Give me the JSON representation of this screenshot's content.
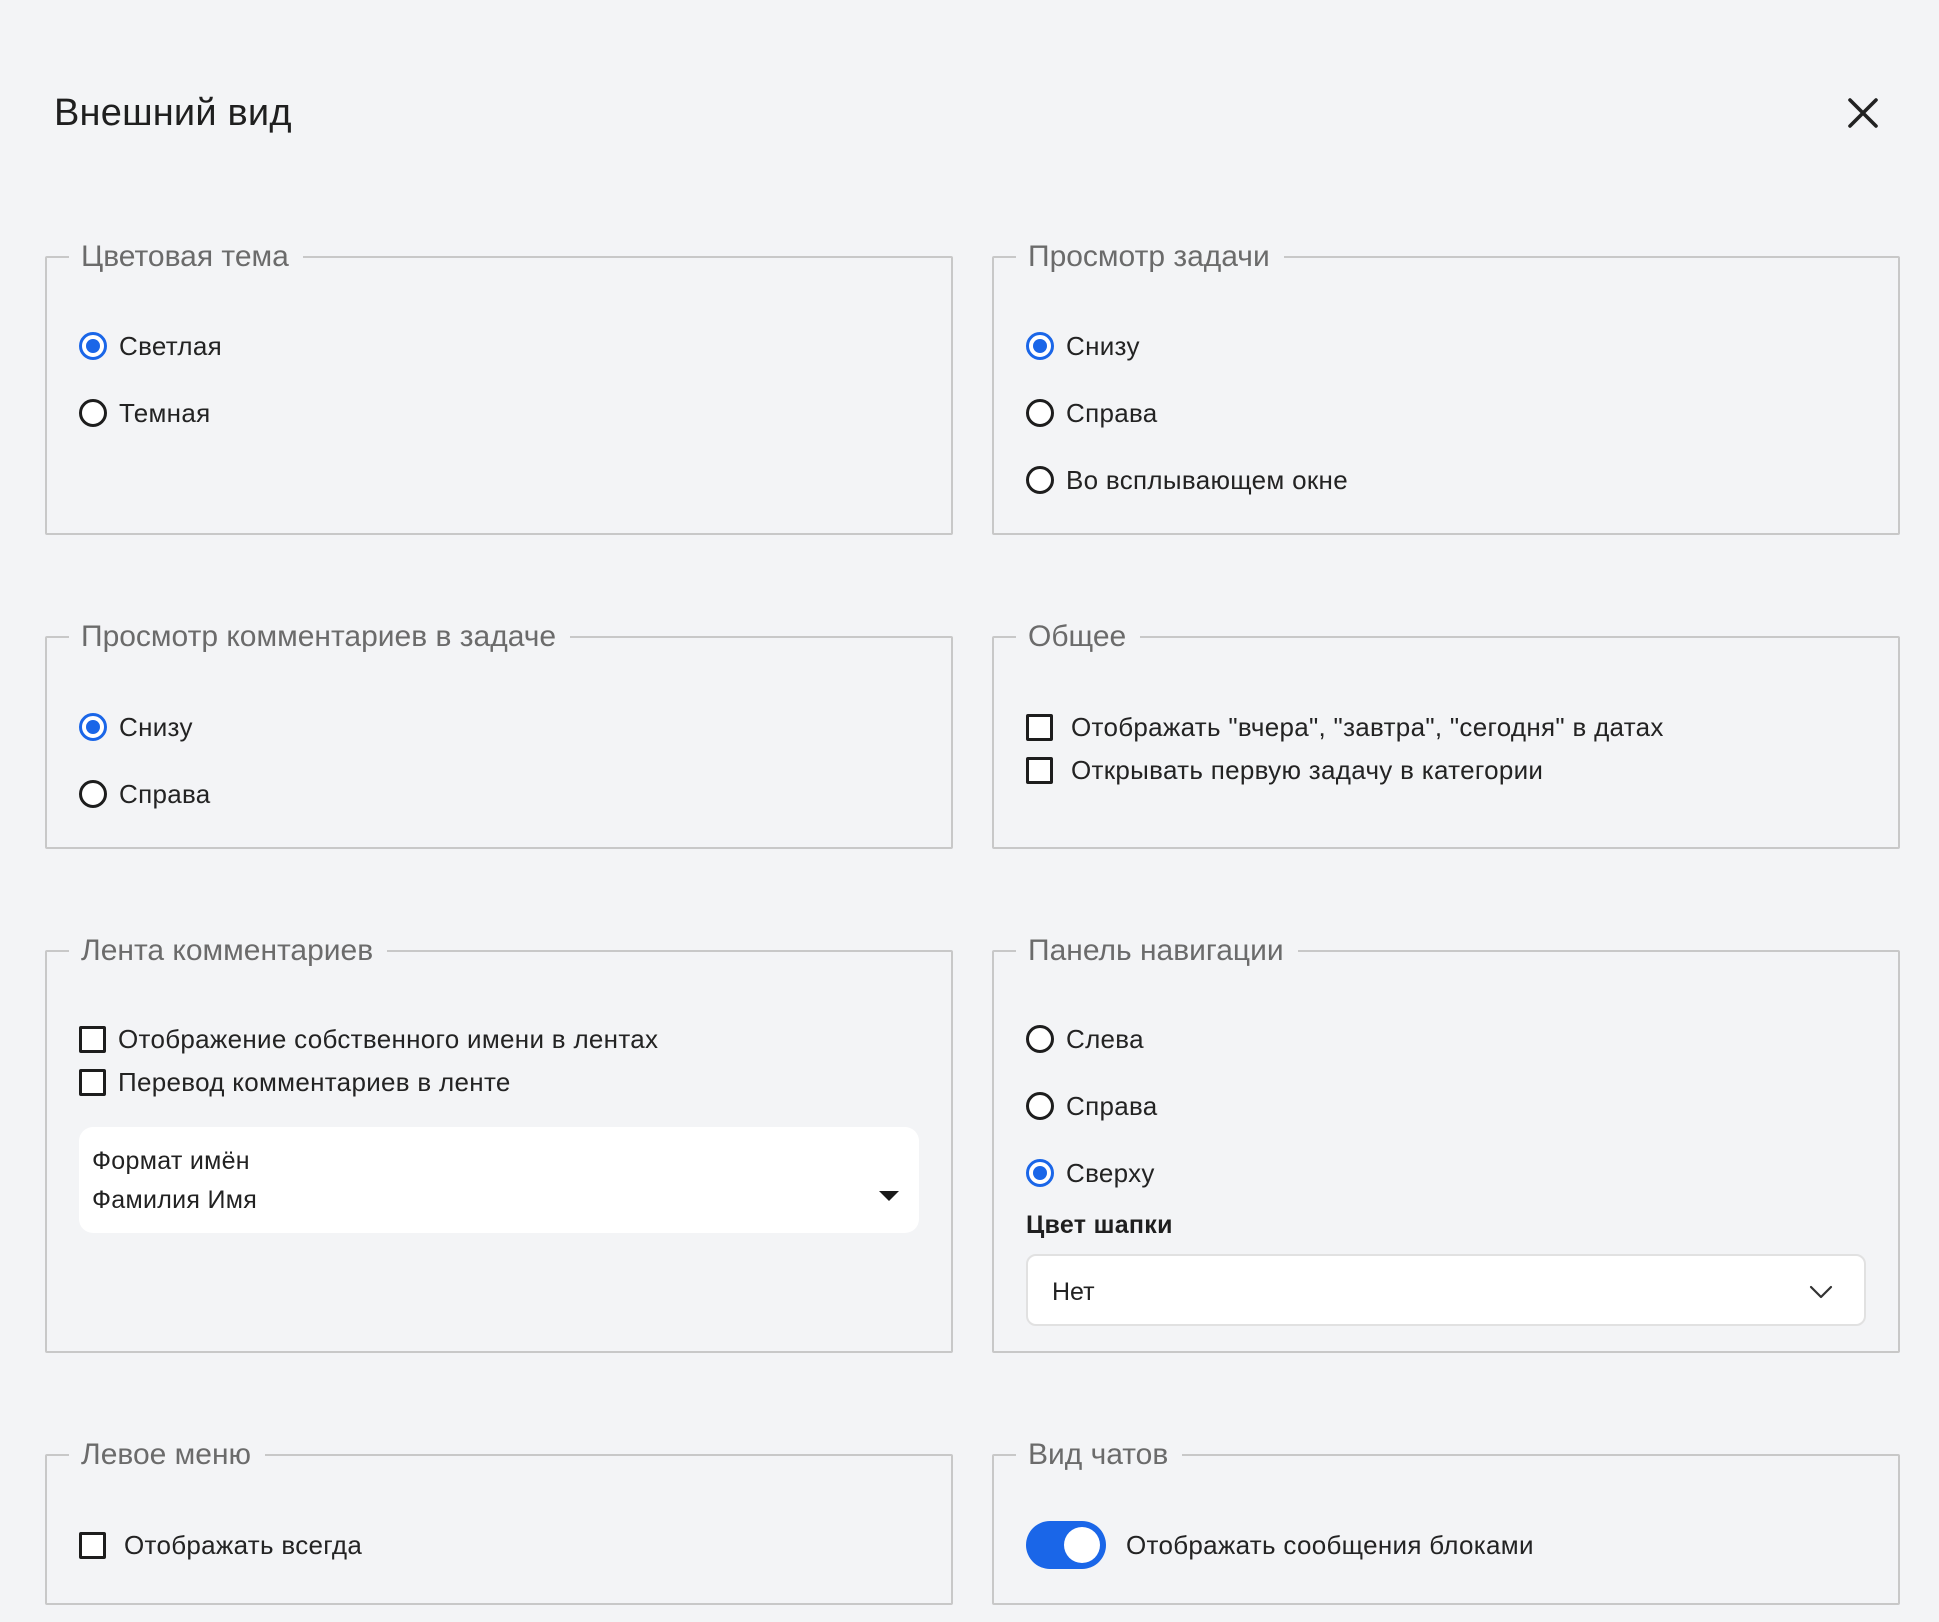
{
  "header": {
    "title": "Внешний вид"
  },
  "color_theme": {
    "title": "Цветовая тема",
    "options": [
      {
        "label": "Светлая",
        "selected": true
      },
      {
        "label": "Темная",
        "selected": false
      }
    ]
  },
  "task_view": {
    "title": "Просмотр задачи",
    "options": [
      {
        "label": "Снизу",
        "selected": true
      },
      {
        "label": "Справа",
        "selected": false
      },
      {
        "label": "Во всплывающем окне",
        "selected": false
      }
    ]
  },
  "comments_view": {
    "title": "Просмотр комментариев в задаче",
    "options": [
      {
        "label": "Снизу",
        "selected": true
      },
      {
        "label": "Справа",
        "selected": false
      }
    ]
  },
  "general": {
    "title": "Общее",
    "checkboxes": [
      {
        "label": "Отображать \"вчера\", \"завтра\", \"сегодня\" в датах",
        "checked": false
      },
      {
        "label": "Открывать первую задачу в категории",
        "checked": false
      }
    ]
  },
  "comment_feed": {
    "title": "Лента комментариев",
    "checkboxes": [
      {
        "label": "Отображение собственного имени в лентах",
        "checked": false
      },
      {
        "label": "Перевод комментариев в ленте",
        "checked": false
      }
    ],
    "name_format": {
      "label": "Формат имён",
      "value": "Фамилия Имя"
    }
  },
  "nav_panel": {
    "title": "Панель навигации",
    "options": [
      {
        "label": "Слева",
        "selected": false
      },
      {
        "label": "Справа",
        "selected": false
      },
      {
        "label": "Сверху",
        "selected": true
      }
    ],
    "header_color": {
      "label": "Цвет шапки",
      "value": "Нет"
    }
  },
  "left_menu": {
    "title": "Левое меню",
    "checkboxes": [
      {
        "label": "Отображать всегда",
        "checked": false
      }
    ]
  },
  "chat_view": {
    "title": "Вид чатов",
    "toggle": {
      "label": "Отображать сообщения блоками",
      "on": true
    }
  },
  "colors": {
    "accent": "#1a66e8",
    "background": "#f3f4f6"
  }
}
